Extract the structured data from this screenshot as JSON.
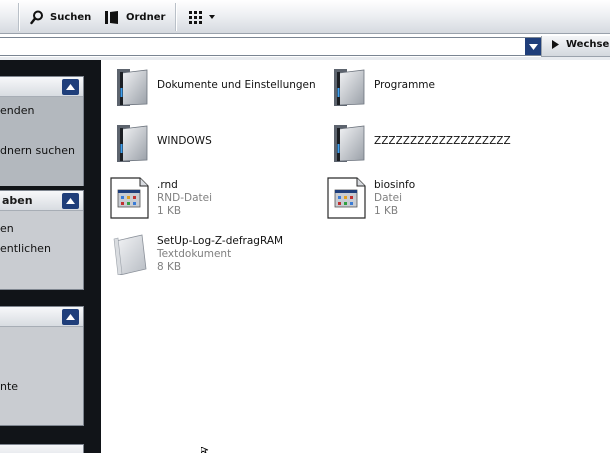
{
  "toolbar": {
    "search_label": "Suchen",
    "folders_label": "Ordner",
    "view_icon": "grid-icon"
  },
  "address": {
    "value": "",
    "go_label": "Wechseln zu"
  },
  "tasks": {
    "group1": {
      "title": "",
      "items": [
        "enden",
        "dnern suchen"
      ]
    },
    "group2": {
      "title": "aben",
      "items": [
        "en",
        "entlichen"
      ]
    },
    "group3": {
      "title": "",
      "items": [
        "nte"
      ]
    }
  },
  "files": [
    {
      "name": "Dokumente und Einstellungen",
      "type": "",
      "size": "",
      "icon": "folder-icon"
    },
    {
      "name": "Programme",
      "type": "",
      "size": "",
      "icon": "folder-icon"
    },
    {
      "name": "WINDOWS",
      "type": "",
      "size": "",
      "icon": "folder-icon"
    },
    {
      "name": "ZZZZZZZZZZZZZZZZZZZ",
      "type": "",
      "size": "",
      "icon": "folder-icon"
    },
    {
      "name": ".rnd",
      "type": "RND-Datei",
      "size": "1 KB",
      "icon": "file-icon"
    },
    {
      "name": "biosinfo",
      "type": "Datei",
      "size": "1 KB",
      "icon": "file-icon"
    },
    {
      "name": "SetUp-Log-Z-defragRAM",
      "type": "Textdokument",
      "size": "8 KB",
      "icon": "text-document-icon"
    }
  ],
  "colors": {
    "accent": "#1f3e7a",
    "pane": "#111418",
    "group": "#c9ccd1",
    "subtext": "#808080"
  }
}
